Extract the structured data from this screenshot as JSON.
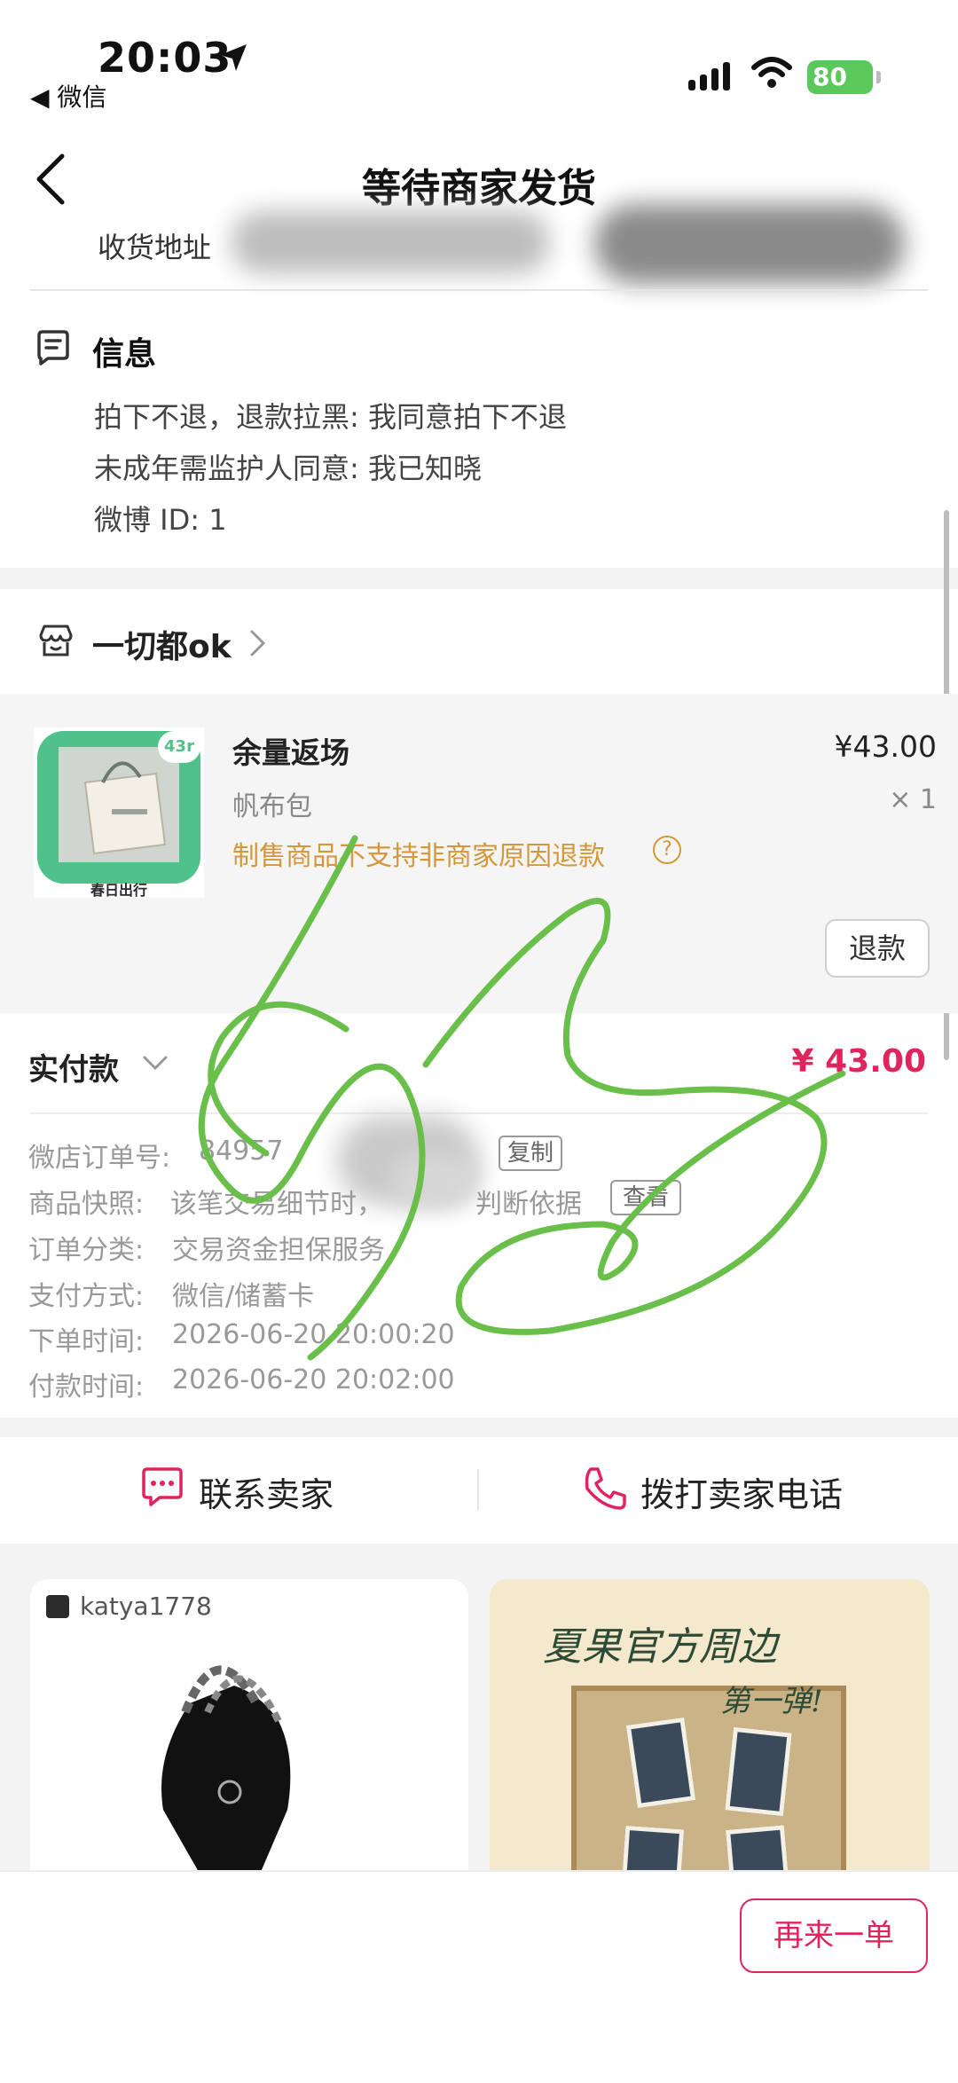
{
  "status_bar": {
    "time": "20:03",
    "back_app": "◀ 微信",
    "battery": "80"
  },
  "nav": {
    "title": "等待商家发货"
  },
  "address": {
    "label": "收货地址"
  },
  "info": {
    "title": "信息",
    "lines": [
      "拍下不退，退款拉黑: 我同意拍下不退",
      "未成年需监护人同意: 我已知晓",
      "微博 ID: 1"
    ]
  },
  "shop": {
    "name": "一切都ok"
  },
  "product": {
    "name": "余量返场",
    "price": "¥43.00",
    "spec": "帆布包",
    "qty": "× 1",
    "warning": "制售商品不支持非商家原因退款",
    "thumb_badge": "43r",
    "thumb_caption": "春日出行",
    "refund_label": "退款"
  },
  "payment": {
    "label": "实付款",
    "amount": "¥ 43.00"
  },
  "details": {
    "order_no_label": "微店订单号:",
    "order_no_value": "84957",
    "copy_label": "复制",
    "snapshot_label": "商品快照:",
    "snapshot_value": "该笔交易细节时，",
    "snapshot_value2": "判断依据",
    "view_label": "查看",
    "category_label": "订单分类:",
    "category_value": "交易资金担保服务",
    "method_label": "支付方式:",
    "method_value": "微信/储蓄卡",
    "order_time_label": "下单时间:",
    "order_time_value": "2026-06-20 20:00:20",
    "pay_time_label": "付款时间:",
    "pay_time_value": "2026-06-20 20:02:00"
  },
  "contact": {
    "seller": "联系卖家",
    "phone": "拨打卖家电话"
  },
  "recommend": {
    "user": "katya1778",
    "card2_title": "夏果官方周边",
    "card2_sub": "第一弹!"
  },
  "bottom": {
    "reorder": "再来一单"
  },
  "colors": {
    "accent": "#e0245e",
    "warning": "#d4973a",
    "battery": "#5ac85a",
    "scribble": "#6abf4b"
  }
}
